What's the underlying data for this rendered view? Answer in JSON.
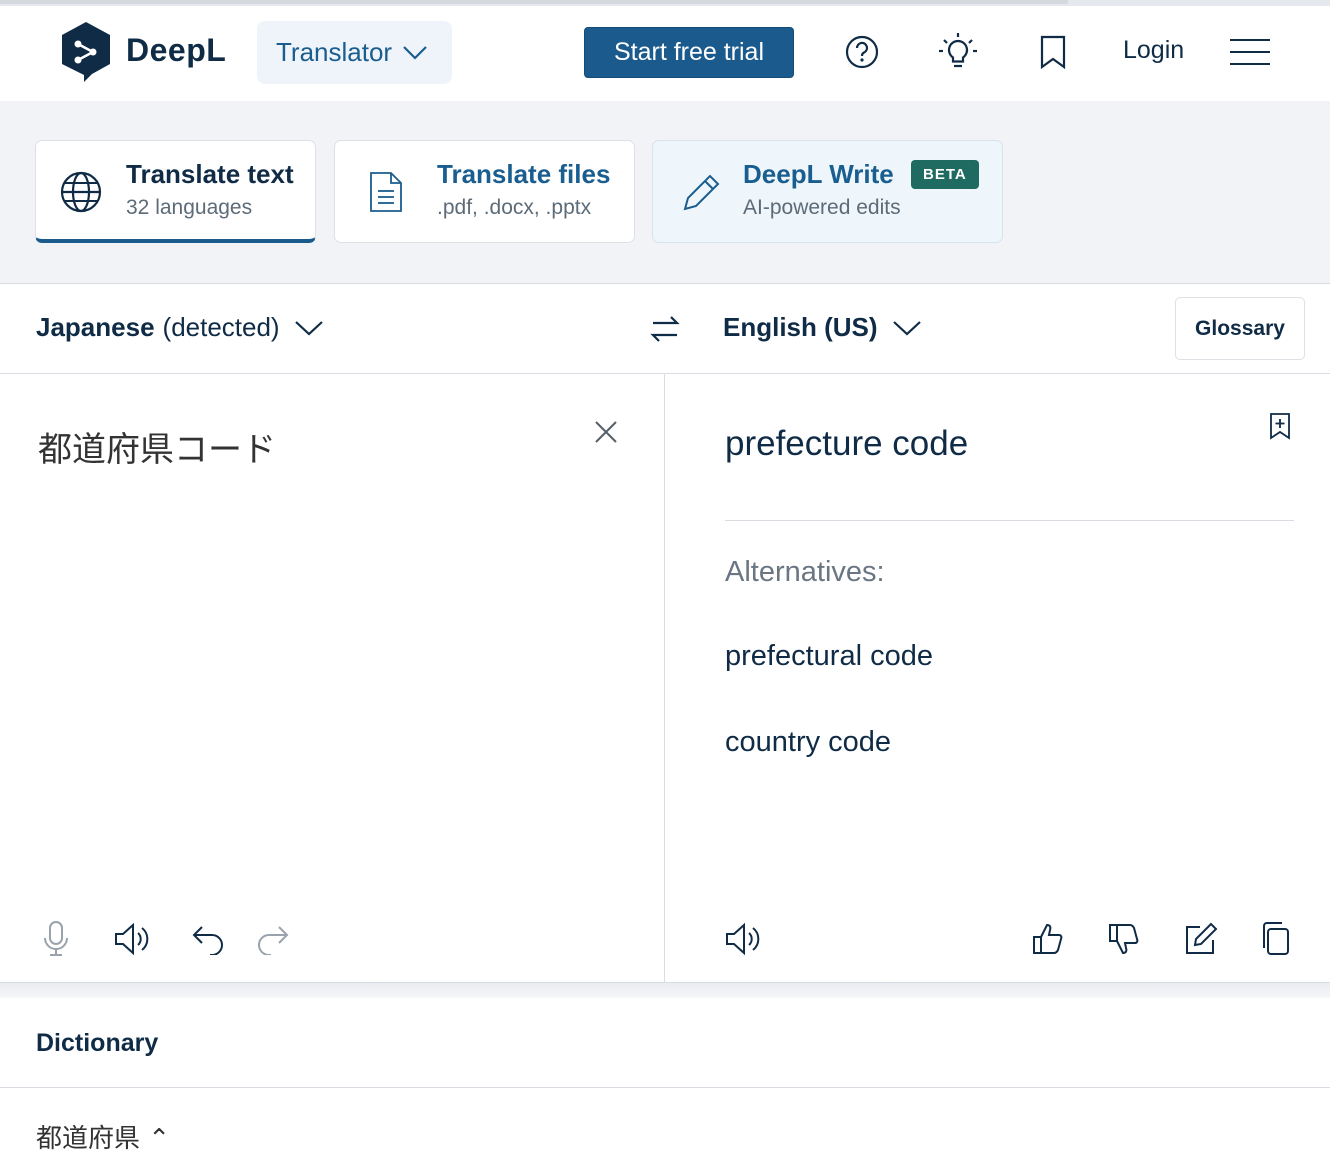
{
  "header": {
    "brand": "DeepL",
    "product_menu": "Translator",
    "trial_button": "Start free trial",
    "login": "Login"
  },
  "modes": [
    {
      "title": "Translate text",
      "subtitle": "32 languages",
      "active": true
    },
    {
      "title": "Translate files",
      "subtitle": ".pdf, .docx, .pptx",
      "active": false
    },
    {
      "title": "DeepL Write",
      "subtitle": "AI-powered edits",
      "badge": "BETA",
      "active": false
    }
  ],
  "languages": {
    "source_name": "Japanese",
    "source_status": "(detected)",
    "target_name": "English (US)",
    "glossary": "Glossary"
  },
  "source": {
    "text": "都道府県コード"
  },
  "target": {
    "text": "prefecture code",
    "alternatives_label": "Alternatives:",
    "alternatives": [
      "prefectural code",
      "country code"
    ]
  },
  "dictionary": {
    "title": "Dictionary",
    "peek": "都道府県 ⌃"
  },
  "colors": {
    "brand_navy": "#0f2b46",
    "accent_blue": "#1a5a8c",
    "beta_green": "#1f6b62"
  }
}
